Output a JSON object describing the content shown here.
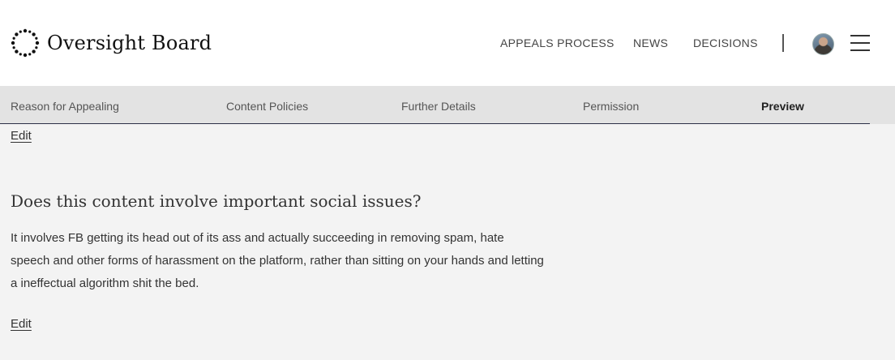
{
  "header": {
    "brand": "Oversight Board",
    "nav": {
      "appeals": "APPEALS PROCESS",
      "news": "NEWS",
      "decisions": "DECISIONS"
    }
  },
  "steps": [
    "Reason for Appealing",
    "Content Policies",
    "Further Details",
    "Permission",
    "Preview"
  ],
  "active_step": "Preview",
  "content": {
    "edit_top": "Edit",
    "question": "Does this content involve important social issues?",
    "answer": "It involves FB getting its head out of its ass and actually succeeding in removing spam, hate speech and other forms of harassment on the platform, rather than sitting on your hands and letting a ineffectual algorithm shit the bed.",
    "edit_bottom": "Edit"
  },
  "icons": {
    "logo": "dotted-circle-logo-icon",
    "menu": "hamburger-menu-icon",
    "avatar": "user-avatar"
  },
  "colors": {
    "header_bg": "#ffffff",
    "steps_bg": "#e3e3e3",
    "page_bg": "#f3f3f3",
    "underline": "#2b2f47"
  }
}
